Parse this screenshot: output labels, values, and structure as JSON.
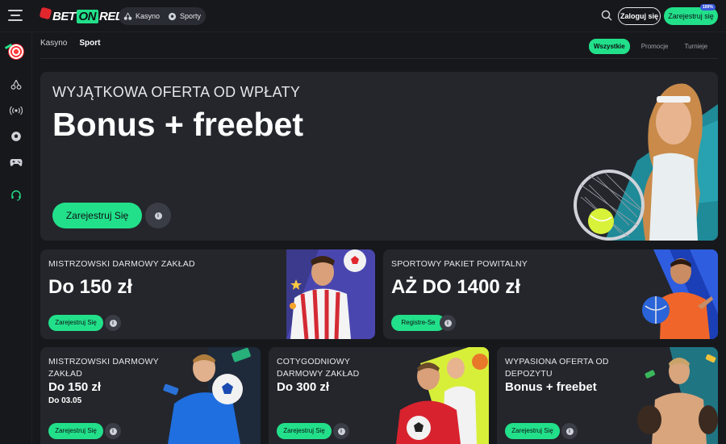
{
  "header": {
    "logo_parts": [
      "BET",
      "ON",
      "RED"
    ],
    "segment": [
      {
        "label": "Kasyno",
        "icon": "cherry-icon"
      },
      {
        "label": "Sporty",
        "icon": "soccer-ball-icon"
      }
    ],
    "login_label": "Zaloguj się",
    "register_label": "Zarejestruj się",
    "register_badge": "100%"
  },
  "rail": [
    "target-icon",
    "cherry-icon",
    "live-signal-icon",
    "soccer-ball-icon",
    "gamepad-icon",
    "headset-icon"
  ],
  "subtabs": [
    {
      "label": "Kasyno",
      "active": false
    },
    {
      "label": "Sport",
      "active": true
    }
  ],
  "filters": [
    {
      "label": "Wszystkie",
      "active": true
    },
    {
      "label": "Promocje",
      "active": false
    },
    {
      "label": "Turnieje",
      "active": false
    }
  ],
  "hero": {
    "kicker": "WYJĄTKOWA OFERTA OD WPŁATY",
    "title": "Bonus + freebet",
    "cta": "Zarejestruj Się"
  },
  "cards": [
    {
      "kicker": "MISTRZOWSKI DARMOWY ZAKŁAD",
      "title": "Do 150 zł",
      "sub": "",
      "cta": "Zarejestruj Się"
    },
    {
      "kicker": "SPORTOWY PAKIET POWITALNY",
      "title": "AŻ DO 1400 zł",
      "sub": "",
      "cta": "Registre-Se"
    },
    {
      "kicker": "MISTRZOWSKI DARMOWY ZAKŁAD",
      "title": "Do 150 zł",
      "sub": "Do 03.05",
      "cta": "Zarejestruj Się"
    },
    {
      "kicker": "COTYGODNIOWY DARMOWY ZAKŁAD",
      "title": "Do 300 zł",
      "sub": "",
      "cta": "Zarejestruj Się"
    },
    {
      "kicker": "WYPASIONA OFERTA OD DEPOZYTU",
      "title": "Bonus + freebet",
      "sub": "",
      "cta": "Zarejestruj Się"
    }
  ],
  "colors": {
    "accent": "#22e08a",
    "brand_red": "#e2262d",
    "surface": "#24262c",
    "background": "#17181c"
  }
}
